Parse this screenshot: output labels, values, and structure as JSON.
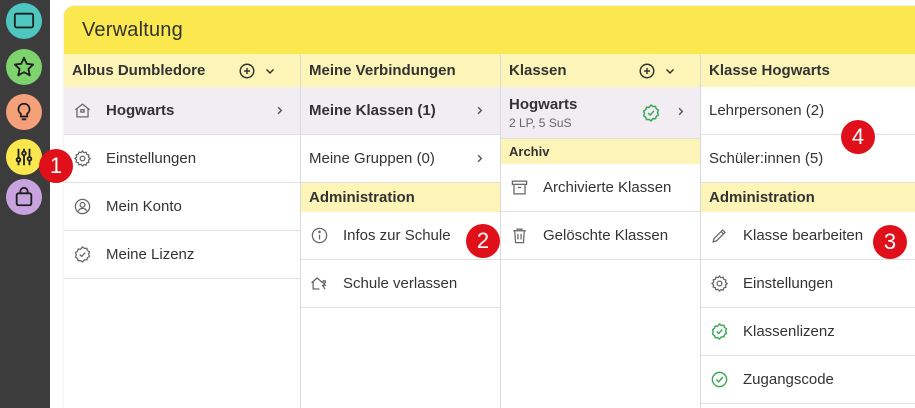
{
  "sidebar": {
    "buttons": [
      {
        "icon": "screen-icon",
        "color": "#4fc7c1"
      },
      {
        "icon": "star-icon",
        "color": "#7ed36f"
      },
      {
        "icon": "lightbulb-icon",
        "color": "#f4a07a"
      },
      {
        "icon": "sliders-icon",
        "color": "#fbe84e"
      },
      {
        "icon": "bag-icon",
        "color": "#c9a3e0"
      }
    ]
  },
  "header": {
    "title": "Verwaltung"
  },
  "col1": {
    "title": "Albus Dumbledore",
    "items": [
      {
        "label": "Hogwarts",
        "icon": "school-icon"
      },
      {
        "label": "Einstellungen",
        "icon": "gear-icon"
      },
      {
        "label": "Mein Konto",
        "icon": "user-icon"
      },
      {
        "label": "Meine Lizenz",
        "icon": "badge-check-icon"
      }
    ]
  },
  "col2": {
    "title": "Meine Verbindungen",
    "items": [
      {
        "label": "Meine Klassen (1)"
      },
      {
        "label": "Meine Gruppen (0)"
      }
    ],
    "section": "Administration",
    "admin": [
      {
        "label": "Infos zur Schule",
        "icon": "info-icon"
      },
      {
        "label": "Schule verlassen",
        "icon": "leave-school-icon"
      }
    ]
  },
  "col3": {
    "title": "Klassen",
    "class_name": "Hogwarts",
    "class_sub": "2 LP, 5 SuS",
    "section": "Archiv",
    "archive": [
      {
        "label": "Archivierte Klassen",
        "icon": "archive-icon"
      },
      {
        "label": "Gelöschte Klassen",
        "icon": "trash-icon"
      }
    ]
  },
  "col4": {
    "title": "Klasse Hogwarts",
    "items": [
      {
        "label": "Lehrpersonen (2)"
      },
      {
        "label": "Schüler:innen (5)"
      }
    ],
    "section": "Administration",
    "admin": [
      {
        "label": "Klasse bearbeiten",
        "icon": "pencil-icon"
      },
      {
        "label": "Einstellungen",
        "icon": "gear-icon"
      },
      {
        "label": "Klassenlizenz",
        "icon": "badge-check-icon"
      },
      {
        "label": "Zugangscode",
        "icon": "check-circle-icon"
      }
    ]
  },
  "badges": [
    "1",
    "2",
    "3",
    "4"
  ],
  "colors": {
    "accent": "#fbe84e",
    "header_bg": "#fdf5b8",
    "active_row": "#f1edf3",
    "badge": "#e0101a",
    "green": "#3aa85a"
  }
}
